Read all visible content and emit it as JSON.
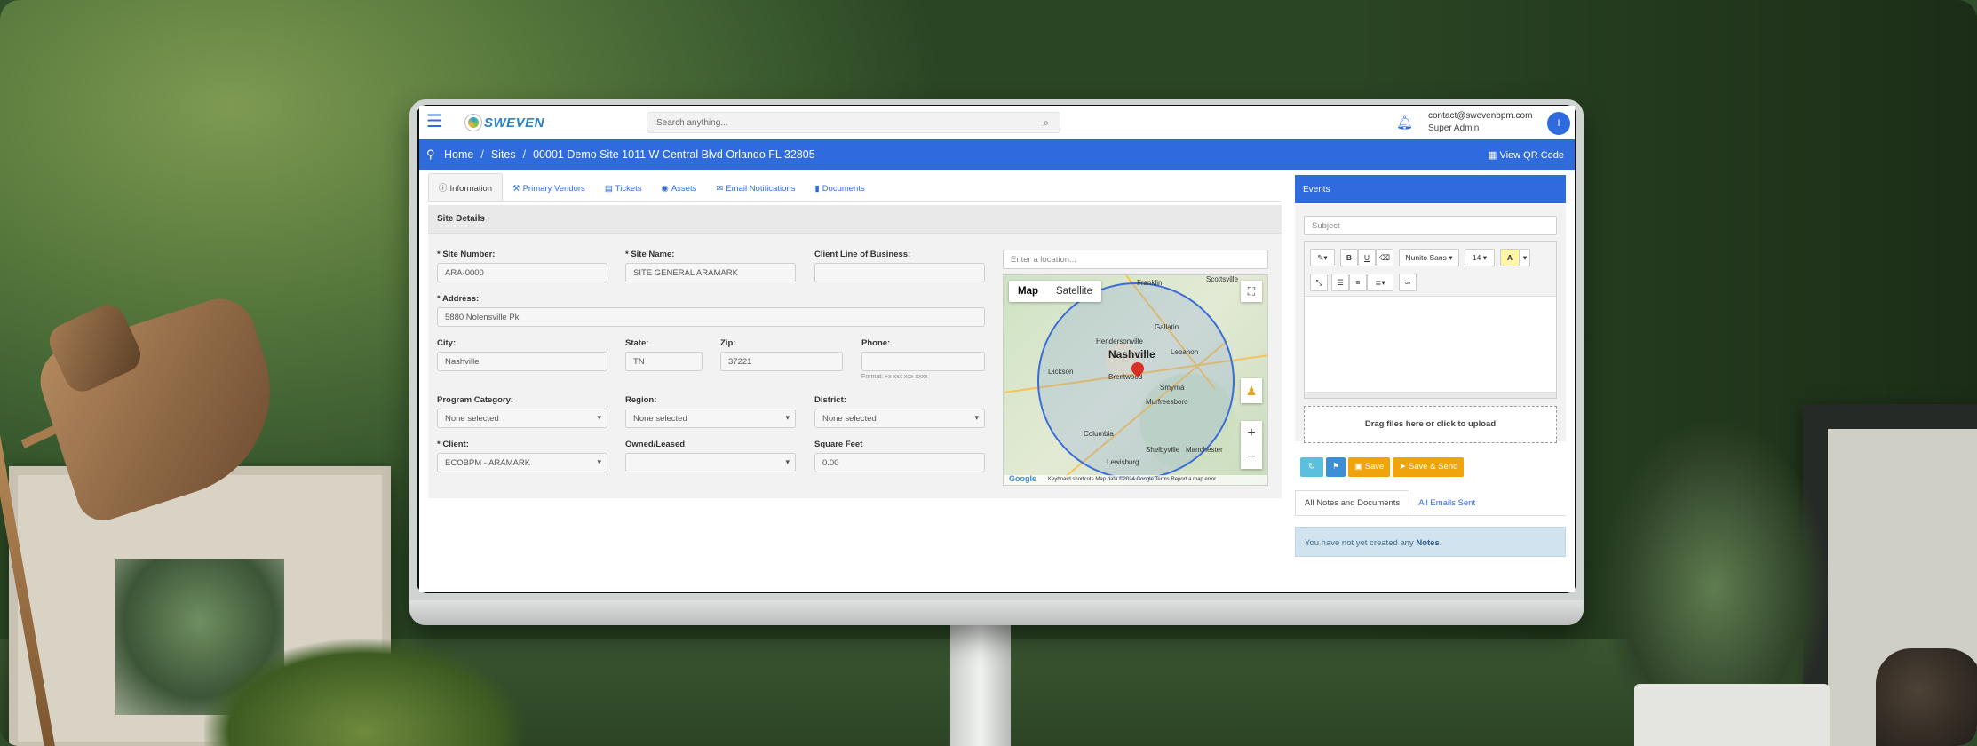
{
  "app": {
    "logo_text": "SWEVEN",
    "search_placeholder": "Search anything...",
    "user_email": "contact@swevenbpm.com",
    "user_role": "Super Admin",
    "avatar_initial": "I"
  },
  "breadcrumb": {
    "home": "Home",
    "sites": "Sites",
    "current": "00001 Demo Site 1011 W Central Blvd Orlando FL 32805",
    "qr_label": "View QR Code"
  },
  "tabs": [
    {
      "label": "Information",
      "icon": "ⓘ"
    },
    {
      "label": "Primary Vendors",
      "icon": "⚒"
    },
    {
      "label": "Tickets",
      "icon": "▤"
    },
    {
      "label": "Assets",
      "icon": "◉"
    },
    {
      "label": "Email Notifications",
      "icon": "✉"
    },
    {
      "label": "Documents",
      "icon": "▮"
    }
  ],
  "site": {
    "section_title": "Site Details",
    "site_number_label": "* Site Number:",
    "site_number": "ARA-0000",
    "site_name_label": "* Site Name:",
    "site_name": "SITE GENERAL ARAMARK",
    "client_lob_label": "Client Line of Business:",
    "client_lob": "",
    "address_label": "* Address:",
    "address": "5880 Nolensville Pk",
    "city_label": "City:",
    "city": "Nashville",
    "state_label": "State:",
    "state": "TN",
    "zip_label": "Zip:",
    "zip": "37221",
    "phone_label": "Phone:",
    "phone": "",
    "phone_hint": "Format: +x xxx xxx xxxx",
    "program_category_label": "Program Category:",
    "program_category": "None selected",
    "region_label": "Region:",
    "region": "None selected",
    "district_label": "District:",
    "district": "None selected",
    "client_label": "* Client:",
    "client": "ECOBPM - ARAMARK",
    "owned_label": "Owned/Leased",
    "owned": "",
    "sqft_label": "Square Feet",
    "sqft": "0.00"
  },
  "map": {
    "location_placeholder": "Enter a location...",
    "type_map": "Map",
    "type_satellite": "Satellite",
    "city_main": "Nashville",
    "cities": [
      "Franklin",
      "Gallatin",
      "Hendersonville",
      "Lebanon",
      "Dickson",
      "Brentwood",
      "Smyrna",
      "Murfreesboro",
      "Columbia",
      "Shelbyville",
      "Manchester",
      "Lewisburg",
      "Scottsville"
    ],
    "attribution": "Keyboard shortcuts   Map data ©2024 Google   Terms   Report a map error",
    "google": "Google"
  },
  "events": {
    "title": "Events",
    "subject_placeholder": "Subject",
    "font_name": "Nunito Sans",
    "font_size": "14",
    "drop_label": "Drag files here or click to upload",
    "save_label": "Save",
    "save_send_label": "Save & Send"
  },
  "notes": {
    "tab_all": "All Notes and Documents",
    "tab_emails": "All Emails Sent",
    "empty_prefix": "You have not yet created any ",
    "empty_link": "Notes",
    "empty_suffix": "."
  }
}
